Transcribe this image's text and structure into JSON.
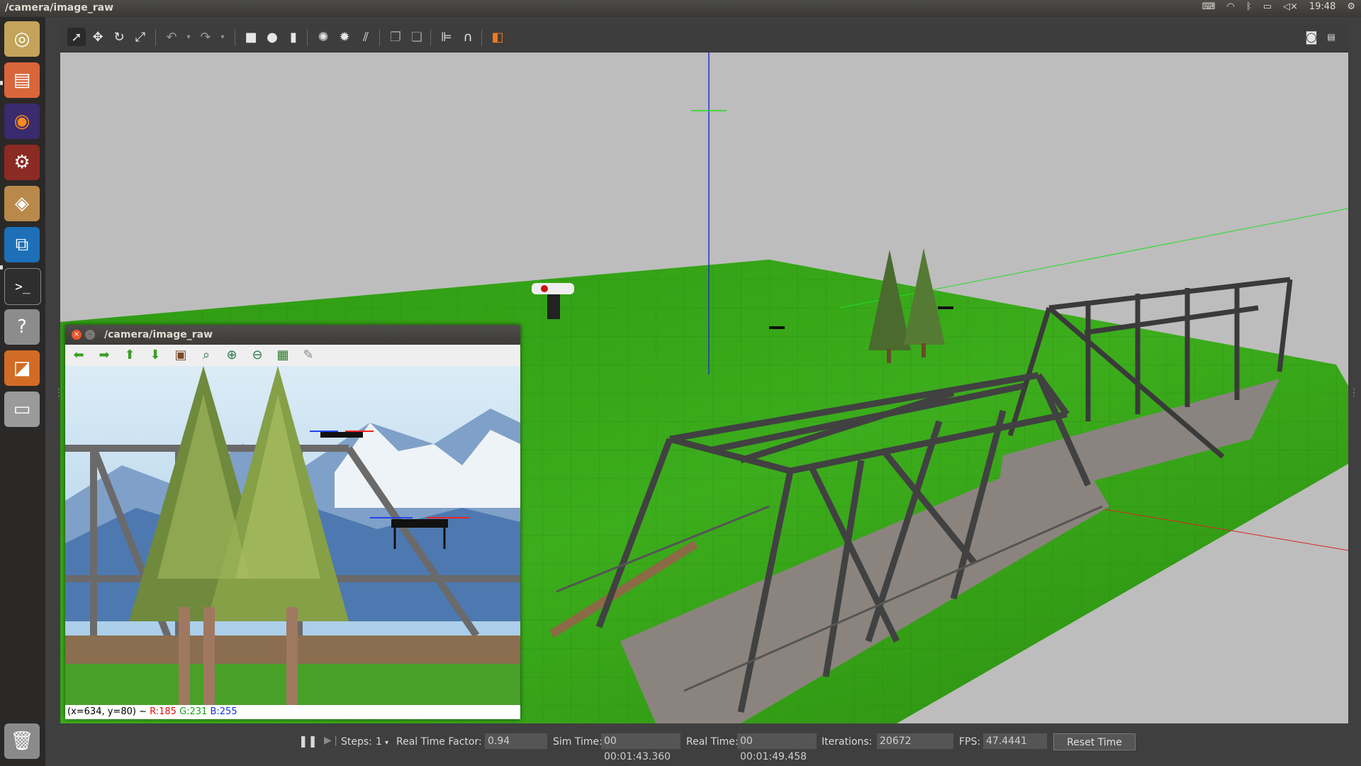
{
  "top_panel": {
    "title": "/camera/image_raw",
    "clock": "19:48"
  },
  "launcher": {
    "items": [
      {
        "name": "dash-home",
        "glyph": "◎",
        "color": "#c8c4b6"
      },
      {
        "name": "files",
        "glyph": "▤",
        "color": "#e06a3a"
      },
      {
        "name": "firefox",
        "glyph": "◉",
        "color": "#ff7b21"
      },
      {
        "name": "system-settings",
        "glyph": "⚙",
        "color": "#c74a3a"
      },
      {
        "name": "archive",
        "glyph": "◈",
        "color": "#c69c5c"
      },
      {
        "name": "vscode",
        "glyph": "⧉",
        "color": "#2378c8"
      },
      {
        "name": "terminal",
        "glyph": ">_",
        "color": "#3a3a3a"
      },
      {
        "name": "help",
        "glyph": "?",
        "color": "#9a9a9a"
      },
      {
        "name": "package-installer",
        "glyph": "◪",
        "color": "#e07a2a"
      },
      {
        "name": "drive",
        "glyph": "▭",
        "color": "#bdbdbd"
      }
    ],
    "trash_glyph": "🗑"
  },
  "gazebo": {
    "bottom": {
      "steps_label": "Steps:",
      "steps_value": "1",
      "rtf_label": "Real Time Factor:",
      "rtf_value": "0.94",
      "sim_time_label": "Sim Time:",
      "sim_time_value": "00 00:01:43.360",
      "real_time_label": "Real Time:",
      "real_time_value": "00 00:01:49.458",
      "iterations_label": "Iterations:",
      "iterations_value": "20672",
      "fps_label": "FPS:",
      "fps_value": "47.4441",
      "reset_label": "Reset Time"
    }
  },
  "image_view": {
    "title": "/camera/image_raw",
    "status_prefix": "(x=634, y=80) ~ ",
    "status_r": "R:185",
    "status_g": "G:231",
    "status_b": "B:255"
  }
}
